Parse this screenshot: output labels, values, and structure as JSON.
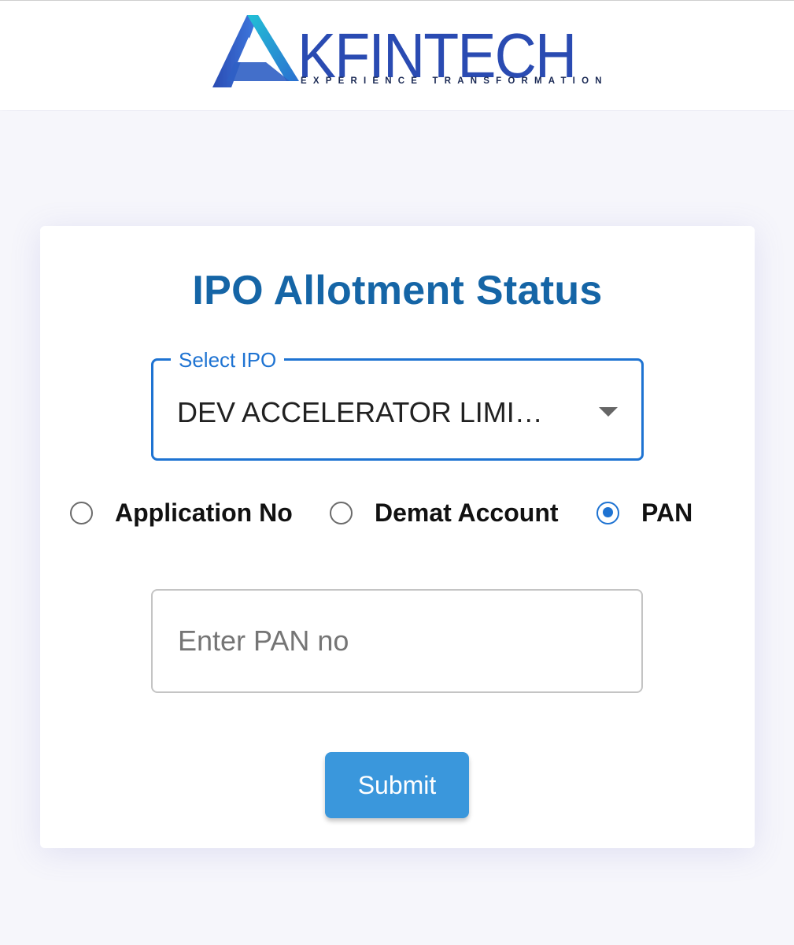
{
  "brand": {
    "name": "KFINTECH",
    "tagline": "EXPERIENCE TRANSFORMATION",
    "colors": {
      "primary": "#2a4bb2",
      "accent": "#1fb8c9"
    }
  },
  "form": {
    "title": "IPO Allotment Status",
    "select_ipo": {
      "label": "Select IPO",
      "value": "DEV ACCELERATOR LIMI…",
      "icon": "dropdown-arrow-icon"
    },
    "search_by": [
      {
        "label": "Application No",
        "checked": false
      },
      {
        "label": "Demat Account",
        "checked": false
      },
      {
        "label": "PAN",
        "checked": true
      }
    ],
    "pan_input": {
      "placeholder": "Enter PAN no",
      "value": ""
    },
    "submit_label": "Submit"
  },
  "colors": {
    "title": "#1565a6",
    "focus_blue": "#1e73d2",
    "button": "#3a97dc"
  }
}
